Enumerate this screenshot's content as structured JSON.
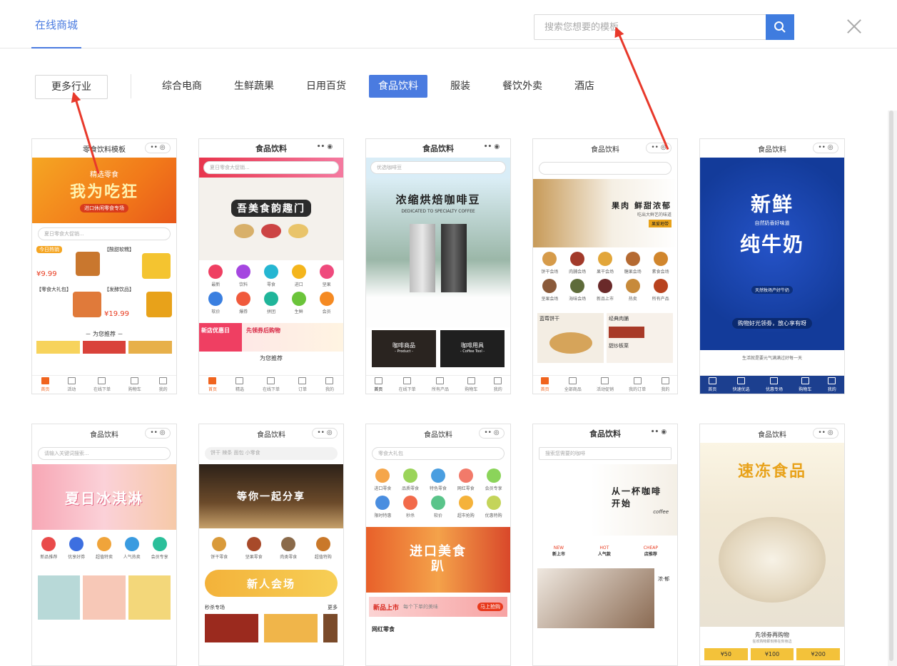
{
  "header": {
    "tab_label": "在线商城",
    "search_placeholder": "搜索您想要的模板"
  },
  "filters": {
    "more_label": "更多行业",
    "categories": [
      "综合电商",
      "生鲜蔬果",
      "日用百货",
      "食品饮料",
      "服装",
      "餐饮外卖",
      "酒店"
    ],
    "active_index": 3
  },
  "templates": [
    {
      "title": "零食饮料模板",
      "search": "夏日零食大促销...",
      "banner": "我为吃狂",
      "sub": "精选零食",
      "tag": "进口休闲零食专场",
      "section": "－ 为您推荐 －",
      "items": [
        "今日热销",
        "【酸甜软糯】",
        "【零食大礼包】",
        "【发酵饮品】"
      ],
      "prices": [
        "¥9.99",
        "¥19.99"
      ],
      "tabs": [
        "首页",
        "活动",
        "在线下单",
        "购物车",
        "我的"
      ]
    },
    {
      "title": "食品饮料",
      "search": "夏日零食大促销...",
      "banner": "吾美食韵趣门",
      "icons": [
        "最新",
        "饮料",
        "零食",
        "进口",
        "坚果",
        "软价",
        "爆券",
        "拼团",
        "生鲜",
        "会员"
      ],
      "promo": "新店优惠日",
      "promo2": "先领券后购物",
      "section": "为您推荐",
      "tabs": [
        "首页",
        "精选",
        "在线下单",
        "订单",
        "我的"
      ]
    },
    {
      "title": "食品饮料",
      "search": "优选咖啡豆",
      "banner": "浓缩烘焙咖啡豆",
      "sub": "DEDICATED TO SPECIALTY COFFEE",
      "tiles": [
        "咖啡商品",
        "咖啡用具"
      ],
      "tiles_sub": [
        "- Product -",
        "- Coffee Tool -"
      ],
      "tabs": [
        "首页",
        "在线下单",
        "所有产品",
        "购物车",
        "我的"
      ]
    },
    {
      "title": "食品饮料",
      "banner": "果肉 鲜甜浓郁",
      "sub": "吃出大鲜艺的味道",
      "btn": "果爱地带",
      "icons": [
        "饼干会场",
        "肉脯会场",
        "果干会场",
        "糖果会场",
        "素食会场",
        "坚果会场",
        "海味会场",
        "新品上市",
        "热卖",
        "所有产品"
      ],
      "deal1": "蓝莓饼干",
      "deal2": "经典肉脯",
      "deal3": "甜炒板栗",
      "tabs": [
        "首页",
        "全部商品",
        "活动促销",
        "我的订单",
        "我的"
      ]
    },
    {
      "title": "食品饮料",
      "banner": "新鲜",
      "banner2": "纯牛奶",
      "sub": "自然奶香好味道",
      "sub2": "天然牧场产好牛奶",
      "footer": "生活就是要元气满满过好每一天",
      "slogan": "购物好光领劵，放心享有呀",
      "tabs": [
        "首页",
        "快速优选",
        "优惠专场",
        "购物车",
        "我的"
      ]
    },
    {
      "title": "食品饮料",
      "search": "请输入关键词搜索...",
      "banner": "夏日冰淇淋",
      "icons": [
        "新品推荐",
        "优享好券",
        "超值特卖",
        "人气热卖",
        "会员专享"
      ]
    },
    {
      "title": "食品饮料",
      "search": "饼干 辣条 面包 小零食",
      "banner": "等你一起分享",
      "icons": [
        "饼干零食",
        "坚果零食",
        "肉类零食",
        "超值特购"
      ],
      "promo": "新人会场",
      "flash": "秒杀专场",
      "more": "更多"
    },
    {
      "title": "食品饮料",
      "search": "零食大礼包",
      "icons": [
        "进口零食",
        "品质零食",
        "特色零食",
        "网红零食",
        "会员专享",
        "限时特惠",
        "秒杀",
        "软价",
        "超市抢购",
        "优惠特购"
      ],
      "banner": "进口美食趴",
      "promo": "新品上市",
      "promo_sub": "每个下单的美味",
      "btn": "马上抢购",
      "section": "网红零食"
    },
    {
      "title": "食品饮料",
      "search": "搜索您需要的咖啡",
      "banner": "从一杯咖啡开始",
      "sub": "coffee",
      "tags": [
        "新上市",
        "人气款",
        "店推荐"
      ],
      "tags_en": [
        "NEW",
        "HOT",
        "CHEAP"
      ],
      "side": "浓·郁"
    },
    {
      "title": "食品饮料",
      "banner": "速冻食品",
      "footer": "先领劵再购物",
      "footer_sub": "狂欢购物即刻劵在你身边",
      "prices": [
        "¥50",
        "¥100",
        "¥200"
      ]
    }
  ]
}
